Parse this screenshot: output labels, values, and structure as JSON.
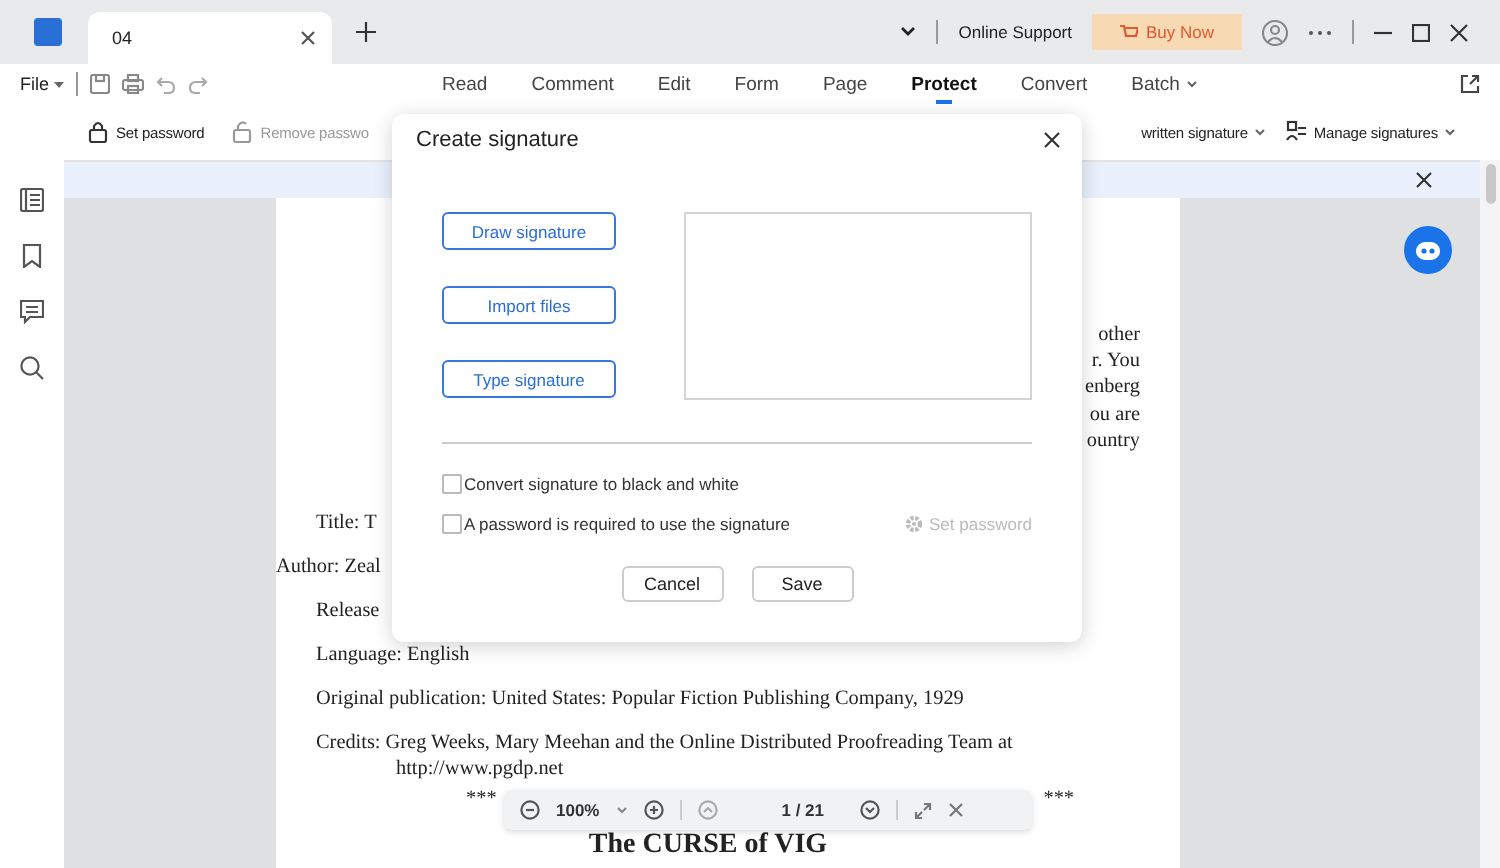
{
  "tab": {
    "title": "04"
  },
  "title_bar": {
    "support": "Online Support",
    "buy": "Buy Now"
  },
  "menu": {
    "file": "File",
    "tabs": [
      {
        "label": "Read",
        "selected": false,
        "dropdown": false
      },
      {
        "label": "Comment",
        "selected": false,
        "dropdown": false
      },
      {
        "label": "Edit",
        "selected": false,
        "dropdown": false
      },
      {
        "label": "Form",
        "selected": false,
        "dropdown": false
      },
      {
        "label": "Page",
        "selected": false,
        "dropdown": false
      },
      {
        "label": "Protect",
        "selected": true,
        "dropdown": false
      },
      {
        "label": "Convert",
        "selected": false,
        "dropdown": false
      },
      {
        "label": "Batch",
        "selected": false,
        "dropdown": true
      }
    ]
  },
  "toolbar": {
    "left": [
      {
        "label": "Set password",
        "kind": "lock",
        "disabled": false
      },
      {
        "label": "Remove passwo",
        "kind": "unlock",
        "disabled": true
      }
    ],
    "right": [
      {
        "label": "written signature",
        "kind": "plain",
        "disabled": false
      },
      {
        "label": "Manage signatures",
        "kind": "signature",
        "disabled": false
      }
    ]
  },
  "dialog": {
    "title": "Create signature",
    "options_buttons": [
      "Draw signature",
      "Import files",
      "Type signature"
    ],
    "checkboxes": [
      {
        "label": "Convert signature to black and white",
        "checked": false
      },
      {
        "label": "A password is required to use the signature",
        "checked": false
      }
    ],
    "set_password": {
      "label": "Set password",
      "disabled": true
    },
    "actions": [
      "Cancel",
      "Save"
    ]
  },
  "document": {
    "fragments": [
      "other",
      "r. You",
      "enberg",
      "ou are",
      "ountry"
    ],
    "lines": [
      {
        "text": "Title: T",
        "kind": "normal"
      },
      {
        "text": "Author: Zeal",
        "kind": "outdent"
      },
      {
        "text": "Release",
        "kind": "normal"
      },
      {
        "text": "Language: English",
        "kind": "normal"
      },
      {
        "text": "Original publication: United States: Popular Fiction Publishing Company, 1929",
        "kind": "normal"
      },
      {
        "text": "Credits: Greg Weeks, Mary Meehan and the Online Distributed Proofreading Team at",
        "kind": "normal"
      },
      {
        "text": "http://www.pgdp.net",
        "kind": "indent"
      }
    ],
    "stars_left": "***",
    "stars_right": "***",
    "heading": "The CURSE of VIG"
  },
  "zoom_bar": {
    "zoom": "100%",
    "page": "1 / 21"
  }
}
